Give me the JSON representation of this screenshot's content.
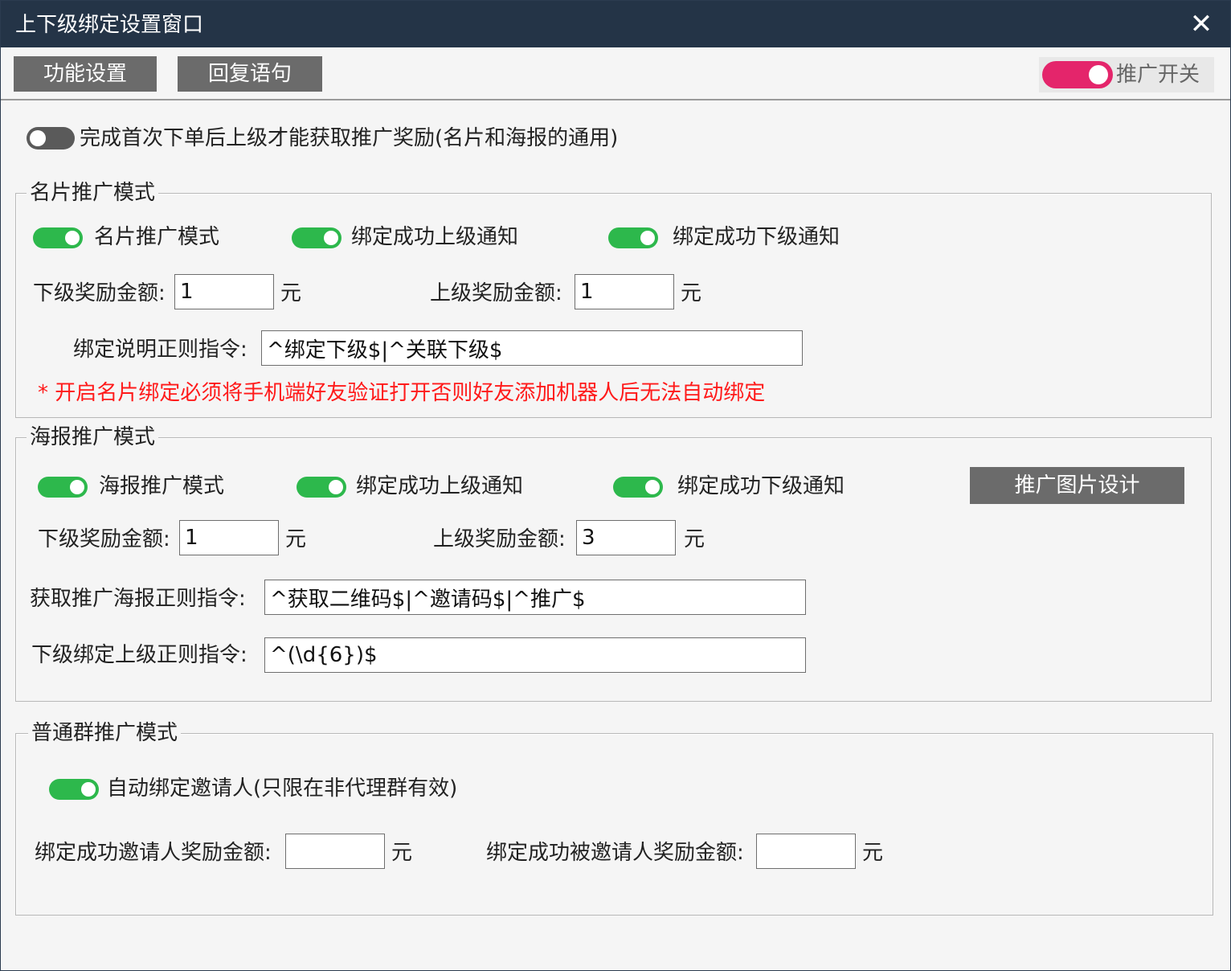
{
  "window": {
    "title": "上下级绑定设置窗口",
    "close_glyph": "✕"
  },
  "toolbar": {
    "function_settings_label": "功能设置",
    "reply_phrases_label": "回复语句",
    "promo_switch_label": "推广开关",
    "promo_switch_on": true
  },
  "first_order": {
    "label": "完成首次下单后上级才能获取推广奖励(名片和海报的通用)",
    "enabled": false
  },
  "card_mode": {
    "group_title": "名片推广模式",
    "toggles": [
      {
        "label": "名片推广模式",
        "on": true
      },
      {
        "label": "绑定成功上级通知",
        "on": true
      },
      {
        "label": "绑定成功下级通知",
        "on": true
      }
    ],
    "sub_reward_label": "下级奖励金额:",
    "sub_reward_value": "1",
    "upper_reward_label": "上级奖励金额:",
    "upper_reward_value": "1",
    "unit": "元",
    "regex_label": "绑定说明正则指令:",
    "regex_value": "^绑定下级$|^关联下级$",
    "warning": "* 开启名片绑定必须将手机端好友验证打开否则好友添加机器人后无法自动绑定"
  },
  "poster_mode": {
    "group_title": "海报推广模式",
    "toggles": [
      {
        "label": "海报推广模式",
        "on": true
      },
      {
        "label": "绑定成功上级通知",
        "on": true
      },
      {
        "label": "绑定成功下级通知",
        "on": true
      }
    ],
    "design_button": "推广图片设计",
    "sub_reward_label": "下级奖励金额:",
    "sub_reward_value": "1",
    "upper_reward_label": "上级奖励金额:",
    "upper_reward_value": "3",
    "unit": "元",
    "get_poster_label": "获取推广海报正则指令:",
    "get_poster_value": "^获取二维码$|^邀请码$|^推广$",
    "bind_upper_label": "下级绑定上级正则指令:",
    "bind_upper_value": "^(\\d{6})$"
  },
  "group_mode": {
    "group_title": "普通群推广模式",
    "toggle_label": "自动绑定邀请人(只限在非代理群有效)",
    "toggle_on": true,
    "inviter_reward_label": "绑定成功邀请人奖励金额:",
    "inviter_reward_value": "",
    "invitee_reward_label": "绑定成功被邀请人奖励金额:",
    "invitee_reward_value": "",
    "unit": "元"
  }
}
